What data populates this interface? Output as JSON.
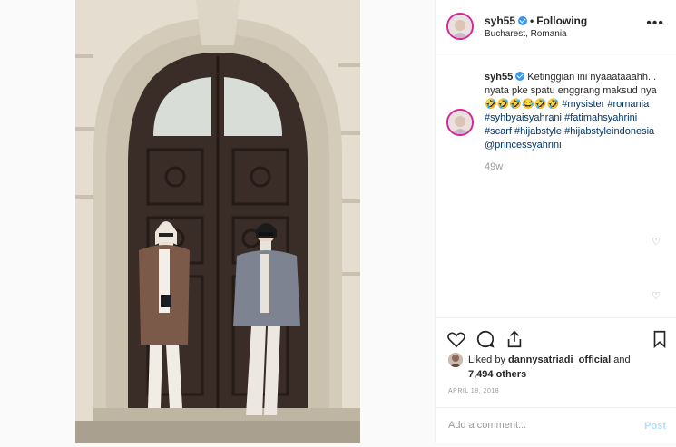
{
  "post": {
    "username": "syh55",
    "follow_status": "Following",
    "location": "Bucharest, Romania",
    "more_icon": "more-horizontal-icon"
  },
  "caption": {
    "username": "syh55",
    "text_1": "Ketinggian ini nyaaataaahh... nyata pke spatu enggrang maksud nya",
    "emojis": "🤣🤣🤣😂🤣🤣",
    "hashtags": [
      "#mysister",
      "#romania",
      "#syhbyaisyahrani",
      "#fatimahsyahrini",
      "#scarf",
      "#hijabstyle",
      "#hijabstyleindonesia",
      "@princessyahrini"
    ],
    "time_ago": "49w"
  },
  "actions": {
    "like_icon": "heart-icon",
    "comment_icon": "comment-icon",
    "share_icon": "share-icon",
    "save_icon": "bookmark-icon"
  },
  "likes": {
    "prefix": "Liked by",
    "liker": "dannysatriadi_official",
    "joiner": "and",
    "others": "7,494 others"
  },
  "date": "APRIL 18, 2018",
  "comment": {
    "placeholder": "Add a comment...",
    "post_label": "Post"
  },
  "colors": {
    "verified": "#3897f0",
    "hashtag": "#003569",
    "post_disabled": "#b2dffc",
    "avatar_ring": "#d6249f"
  }
}
